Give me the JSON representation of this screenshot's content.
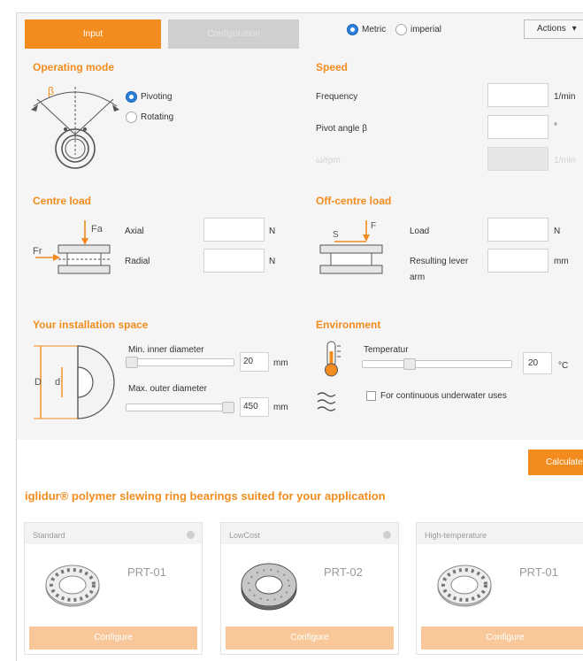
{
  "tabs": {
    "input": "Input",
    "configuration": "Configuration"
  },
  "units_toggle": {
    "metric": "Metric",
    "imperial": "imperial",
    "selected": "metric"
  },
  "actions": {
    "label": "Actions",
    "caret": "▾"
  },
  "operating_mode": {
    "title": "Operating mode",
    "angle_symbol": "β",
    "options": [
      {
        "label": "Pivoting",
        "selected": true
      },
      {
        "label": "Rotating",
        "selected": false
      }
    ]
  },
  "speed": {
    "title": "Speed",
    "frequency_label": "Frequency",
    "frequency_value": "",
    "frequency_unit": "1/min",
    "pivot_label": "Pivot angle β",
    "pivot_value": "",
    "pivot_unit": "°",
    "disabled_label": "ω/rpm",
    "disabled_unit": "1/min"
  },
  "centre_load": {
    "title": "Centre load",
    "fa_symbol": "Fa",
    "fr_symbol": "Fr",
    "axial_label": "Axial",
    "axial_value": "",
    "axial_unit": "N",
    "radial_label": "Radial",
    "radial_value": "",
    "radial_unit": "N"
  },
  "off_centre_load": {
    "title": "Off-centre load",
    "f_symbol": "F",
    "s_symbol": "S",
    "load_label": "Load",
    "load_value": "",
    "load_unit": "N",
    "lever_label_1": "Resulting lever",
    "lever_label_2": "arm",
    "lever_value": "",
    "lever_unit": "mm"
  },
  "installation": {
    "title": "Your installation space",
    "d_outer_symbol": "D",
    "d_inner_symbol": "d",
    "min_inner_label": "Min. inner diameter",
    "min_inner_value": "20",
    "min_inner_unit": "mm",
    "max_outer_label": "Max. outer diameter",
    "max_outer_value": "450",
    "max_outer_unit": "mm"
  },
  "environment": {
    "title": "Environment",
    "temp_label": "Temperatur",
    "temp_value": "20",
    "temp_unit": "°C",
    "underwater_label": "For continuous underwater uses",
    "underwater_checked": false
  },
  "calculate": {
    "label": "Calculate"
  },
  "results": {
    "heading": "iglidur® polymer slewing ring bearings suited for your application",
    "cards": [
      {
        "category": "Standard",
        "model": "PRT-01",
        "button": "Configure"
      },
      {
        "category": "LowCost",
        "model": "PRT-02",
        "button": "Configure"
      },
      {
        "category": "High-temperature",
        "model": "PRT-01",
        "button": "Configure"
      }
    ]
  },
  "colors": {
    "accent": "#f28c1e",
    "accent_light": "#f8c89a",
    "radio_selected": "#2b7fd8",
    "panel": "#f5f5f5"
  }
}
